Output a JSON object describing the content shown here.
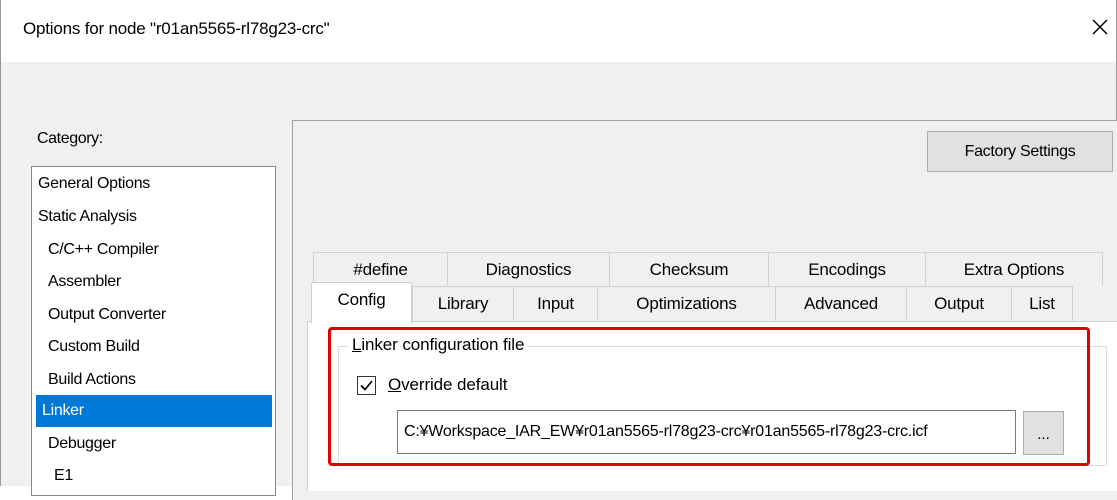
{
  "window": {
    "title": "Options for node \"r01an5565-rl78g23-crc\"",
    "close_icon": "close-icon"
  },
  "category": {
    "label": "Category:",
    "items": [
      {
        "label": "General Options",
        "level": 0,
        "selected": false
      },
      {
        "label": "Static Analysis",
        "level": 0,
        "selected": false
      },
      {
        "label": "C/C++ Compiler",
        "level": 1,
        "selected": false
      },
      {
        "label": "Assembler",
        "level": 1,
        "selected": false
      },
      {
        "label": "Output Converter",
        "level": 1,
        "selected": false
      },
      {
        "label": "Custom Build",
        "level": 1,
        "selected": false
      },
      {
        "label": "Build Actions",
        "level": 1,
        "selected": false
      },
      {
        "label": "Linker",
        "level": 1,
        "selected": true
      },
      {
        "label": "Debugger",
        "level": 1,
        "selected": false
      },
      {
        "label": "E1",
        "level": 2,
        "selected": false
      }
    ]
  },
  "factory_settings_label": "Factory Settings",
  "tabs": {
    "row1": [
      "#define",
      "Diagnostics",
      "Checksum",
      "Encodings",
      "Extra Options"
    ],
    "row2": [
      "Config",
      "Library",
      "Input",
      "Optimizations",
      "Advanced",
      "Output",
      "List"
    ],
    "active": "Config"
  },
  "linker_config": {
    "group_title": "Linker configuration file",
    "override_label": "Override default",
    "override_checked": true,
    "path_value": "C:¥Workspace_IAR_EW¥r01an5565-rl78g23-crc¥r01an5565-rl78g23-crc.icf",
    "browse_label": "..."
  },
  "colors": {
    "selection": "#0078d7",
    "highlight": "#e00000"
  }
}
